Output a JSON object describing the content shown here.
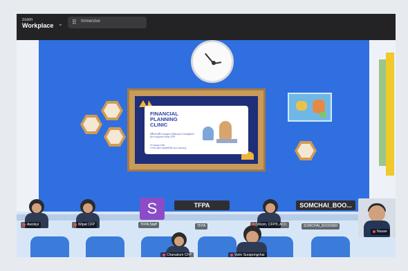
{
  "app": {
    "brand_line1": "zoom",
    "brand_line2": "Workplace",
    "chevron_icon": "chevron-down-icon"
  },
  "search": {
    "label": "Immersive",
    "icon": "grid-icon"
  },
  "slide": {
    "title": "FINANCIAL\nPLANNING\nCLINIC",
    "subtitle": "ปรึกษาฟรีวางแผนการเงินและการลงทุนกับนักวางแผนการเงิน CFP",
    "footer": "TF Sabaai 3 8th\nการประชุมระบบออนไลน์ Zoom Meeting"
  },
  "participants": [
    {
      "id": "p1",
      "name": "Awoleyi"
    },
    {
      "id": "p2",
      "name": "Wipat CFP"
    },
    {
      "id": "p3",
      "name": "TFPA Staff",
      "initial": "S"
    },
    {
      "id": "p4",
      "name": "TFPA"
    },
    {
      "id": "p5",
      "name": "Vikorn, CFP®, ACC"
    },
    {
      "id": "p6",
      "name": "SOMCHAI_BOONSRI"
    },
    {
      "id": "p7",
      "name": "Nuuae"
    },
    {
      "id": "p8",
      "name": "Chanakorn CFP"
    },
    {
      "id": "p9",
      "name": "Varin Surapongchai"
    }
  ],
  "tiles_text": {
    "tfpa_banner": "TFPA",
    "somchai_banner": "SOMCHAI_BOO..."
  },
  "colors": {
    "wall": "#2f6fe0",
    "accent_yellow": "#f0c92a",
    "slide_blue": "#1e2e78",
    "purple_avatar": "#8c4cc7"
  }
}
